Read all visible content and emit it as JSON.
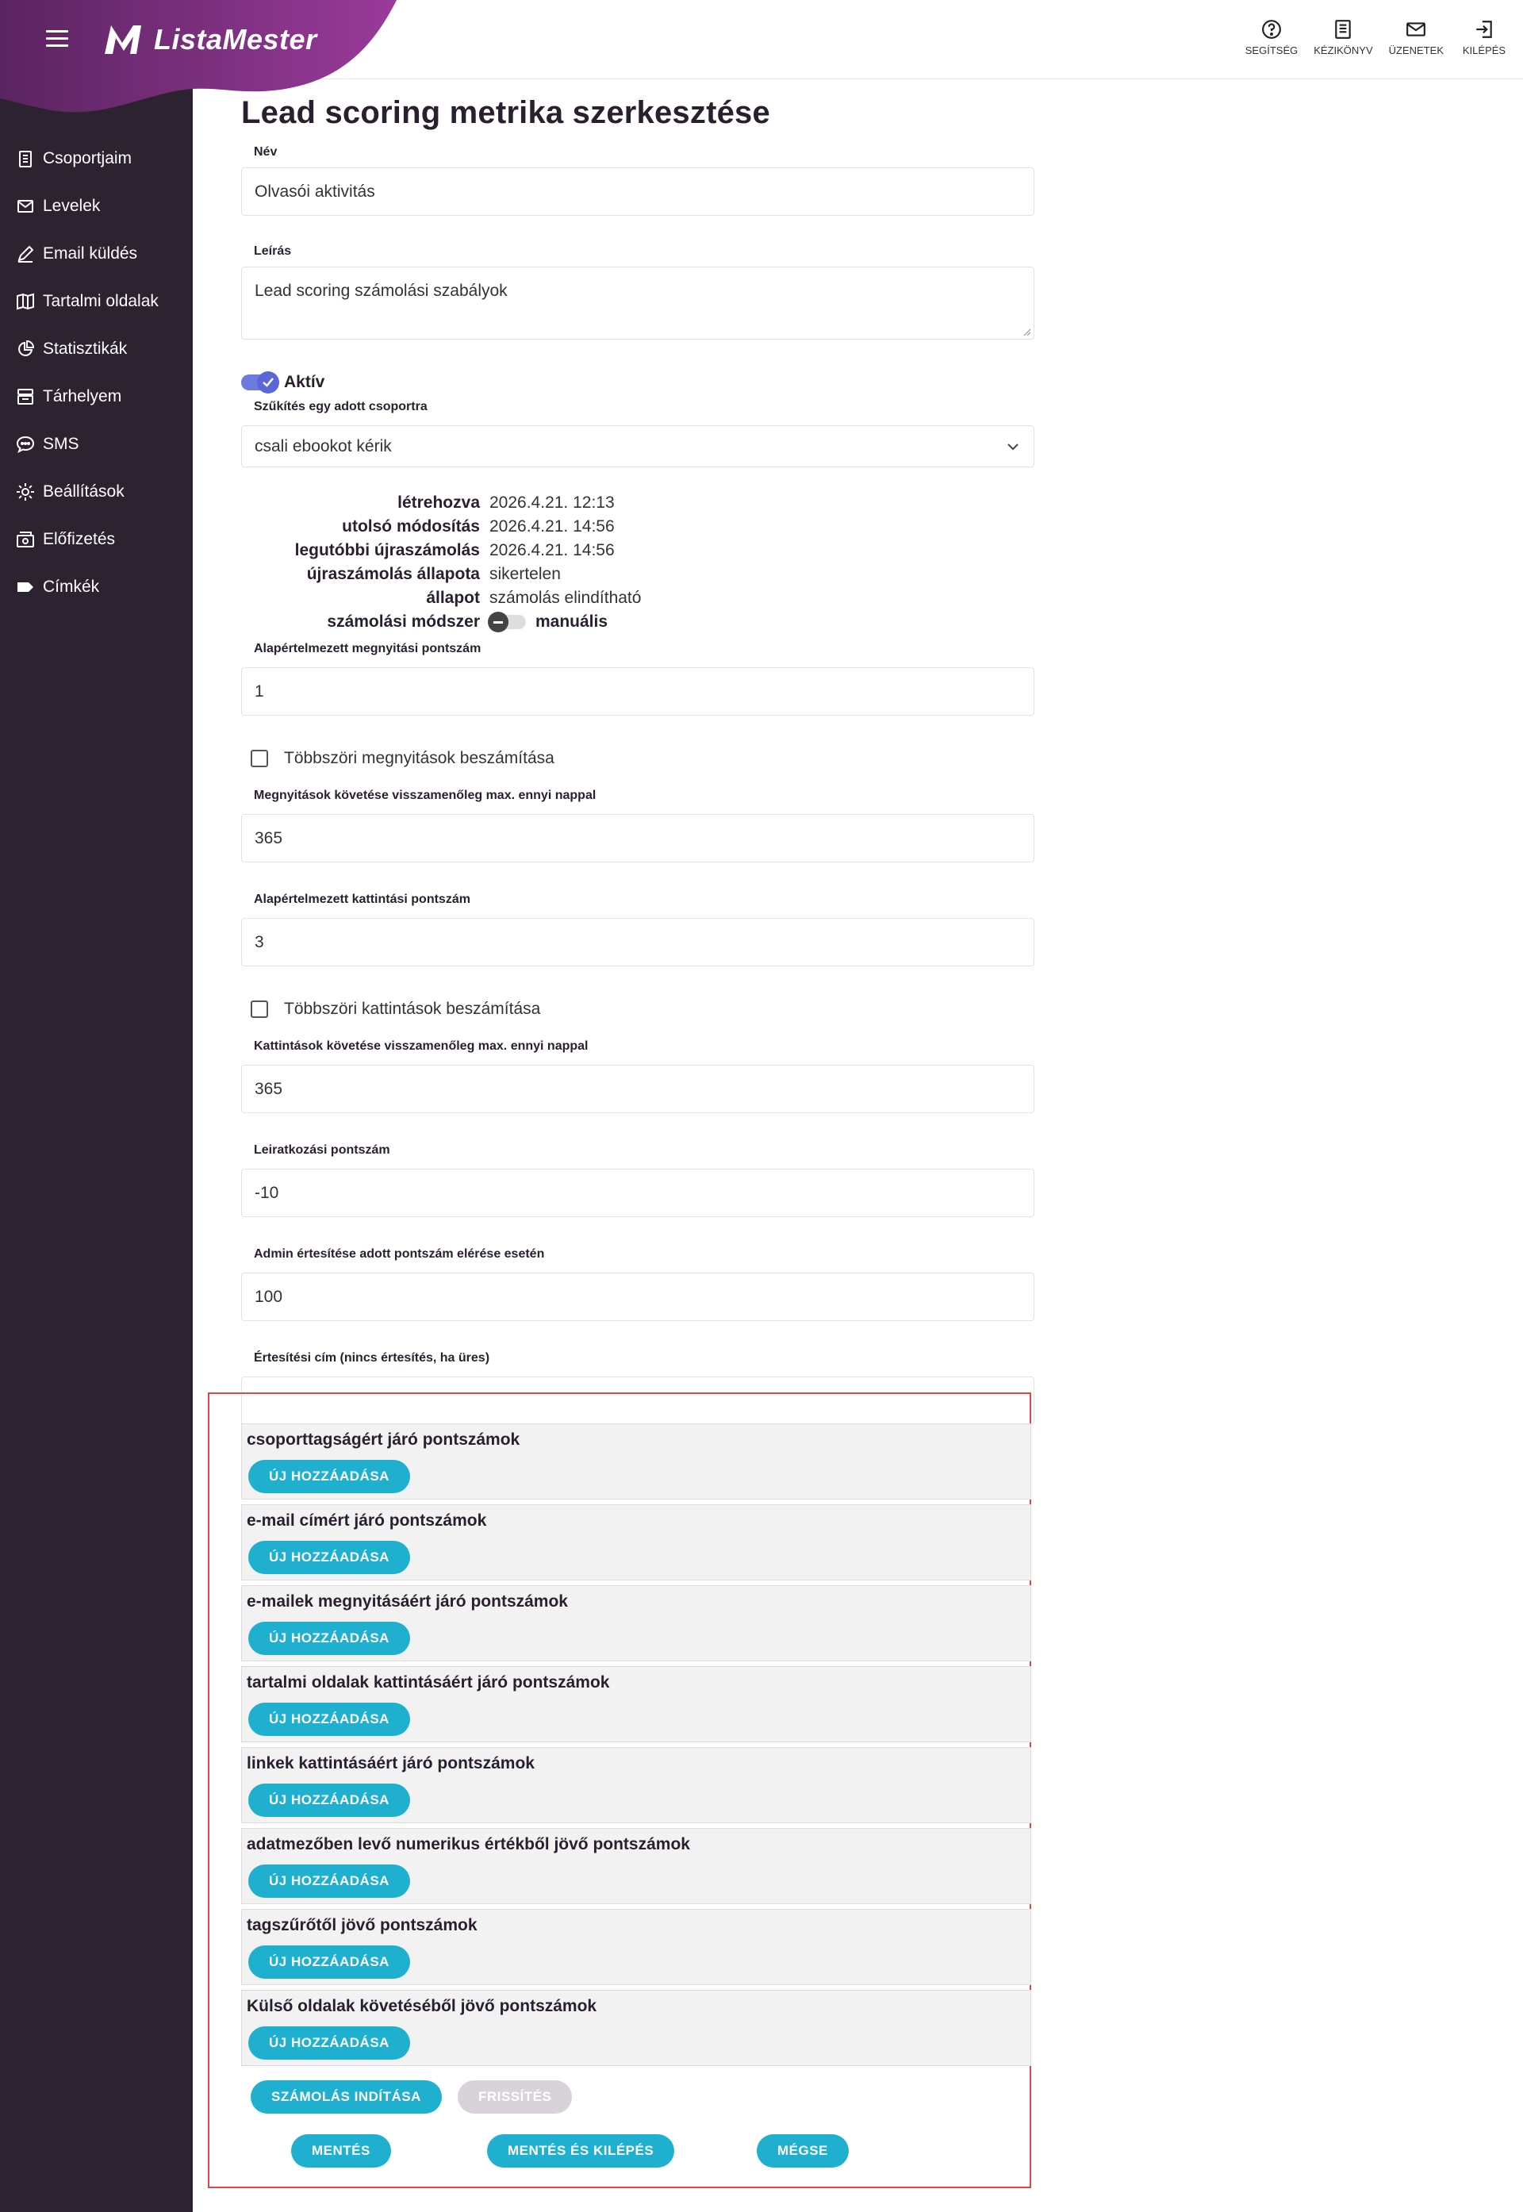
{
  "brand": {
    "name": "ListaMester"
  },
  "sidebar": {
    "items": [
      {
        "label": "Csoportjaim",
        "icon": "clipboard-icon"
      },
      {
        "label": "Levelek",
        "icon": "mail-icon"
      },
      {
        "label": "Email küldés",
        "icon": "pencil-icon"
      },
      {
        "label": "Tartalmi oldalak",
        "icon": "book-icon"
      },
      {
        "label": "Statisztikák",
        "icon": "pie-chart-icon"
      },
      {
        "label": "Tárhelyem",
        "icon": "storage-icon"
      },
      {
        "label": "SMS",
        "icon": "sms-icon"
      },
      {
        "label": "Beállítások",
        "icon": "gear-icon"
      },
      {
        "label": "Előfizetés",
        "icon": "subscription-icon"
      },
      {
        "label": "Címkék",
        "icon": "tag-icon"
      }
    ]
  },
  "topbar": {
    "help": "SEGÍTSÉG",
    "manual": "KÉZIKÖNYV",
    "messages": "ÜZENETEK",
    "logout": "KILÉPÉS"
  },
  "form": {
    "title": "Lead scoring metrika szerkesztése",
    "name_label": "Név",
    "name_value": "Olvasói aktivitás",
    "desc_label": "Leírás",
    "desc_value": "Lead scoring számolási szabályok",
    "active_label": "Aktív",
    "active": true,
    "group_label": "Szűkítés egy adott csoportra",
    "group_value": "csali ebookot kérik",
    "info": {
      "created_k": "létrehozva",
      "created_v": "2026.4.21. 12:13",
      "modified_k": "utolsó módosítás",
      "modified_v": "2026.4.21. 14:56",
      "recalc_k": "legutóbbi újraszámolás",
      "recalc_v": "2026.4.21. 14:56",
      "recalc_state_k": "újraszámolás állapota",
      "recalc_state_v": "sikertelen",
      "state_k": "állapot",
      "state_v": "számolás elindítható",
      "method_k": "számolási módszer",
      "method_v": "manuális"
    },
    "open_score_label": "Alapértelmezett megnyitási pontszám",
    "open_score_value": "1",
    "multi_open_label": "Többszöri megnyitások beszámítása",
    "open_days_label": "Megnyitások követése visszamenőleg max. ennyi nappal",
    "open_days_value": "365",
    "click_score_label": "Alapértelmezett kattintási pontszám",
    "click_score_value": "3",
    "multi_click_label": "Többszöri kattintások beszámítása",
    "click_days_label": "Kattintások követése visszamenőleg max. ennyi nappal",
    "click_days_value": "365",
    "unsub_label": "Leiratkozási pontszám",
    "unsub_value": "-10",
    "admin_label": "Admin értesítése adott pontszám elérése esetén",
    "admin_value": "100",
    "notify_label": "Értesítési cím (nincs értesítés, ha üres)",
    "notify_value": ""
  },
  "blocks": [
    "csoporttagságért járó pontszámok",
    "e-mail címért járó pontszámok",
    "e-mailek megnyitásáért járó pontszámok",
    "tartalmi oldalak kattintásáért járó pontszámok",
    "linkek kattintásáért járó pontszámok",
    "adatmezőben levő numerikus értékből jövő pontszámok",
    "tagszűrőtől jövő pontszámok",
    "Külső oldalak követéséből jövő pontszámok"
  ],
  "buttons": {
    "add_new": "ÚJ HOZZÁADÁSA",
    "start_calc": "SZÁMOLÁS INDÍTÁSA",
    "refresh": "FRISSÍTÉS",
    "save": "MENTÉS",
    "save_exit": "MENTÉS ÉS KILÉPÉS",
    "cancel": "MÉGSE"
  },
  "colors": {
    "sidebar": "#2d2230",
    "brand_purple": "#7a2d83",
    "accent": "#1fb0d0",
    "highlight": "#e04848"
  }
}
